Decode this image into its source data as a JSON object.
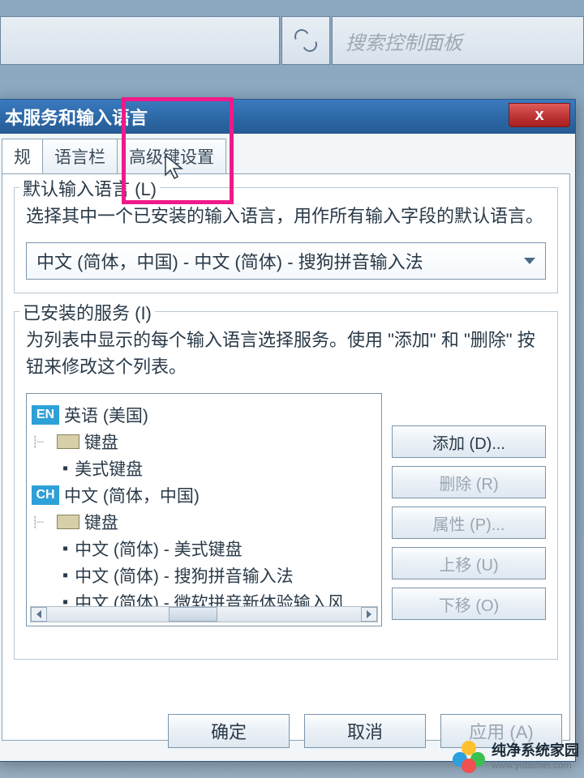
{
  "toolbar": {
    "search_placeholder": "搜索控制面板"
  },
  "dialog": {
    "title": "本服务和输入语言",
    "close_label": "x"
  },
  "tabs": {
    "general": "规",
    "language_bar": "语言栏",
    "advanced": "高级键设置"
  },
  "default_lang": {
    "legend": "默认输入语言 (L)",
    "desc": "选择其中一个已安装的输入语言，用作所有输入字段的默认语言。",
    "combo_value": "中文 (简体，中国) - 中文 (简体) - 搜狗拼音输入法"
  },
  "installed": {
    "legend": "已安装的服务 (I)",
    "desc": "为列表中显示的每个输入语言选择服务。使用 \"添加\" 和 \"删除\" 按钮来修改这个列表。",
    "tree": {
      "en_badge": "EN",
      "en_label": "英语 (美国)",
      "kb_label": "键盘",
      "en_kb1": "美式键盘",
      "ch_badge": "CH",
      "ch_label": "中文 (简体，中国)",
      "ch_kb1": "中文 (简体) - 美式键盘",
      "ch_kb2": "中文 (简体) - 搜狗拼音输入法",
      "ch_kb3": "中文 (简体) - 微软拼音新体验输入风"
    },
    "buttons": {
      "add": "添加 (D)...",
      "remove": "删除 (R)",
      "properties": "属性 (P)...",
      "move_up": "上移 (U)",
      "move_down": "下移 (O)"
    }
  },
  "bottom": {
    "ok": "确定",
    "cancel": "取消",
    "apply": "应用 (A)"
  },
  "watermark": {
    "brand": "纯净系统家园",
    "url": "www.yidaimei.com"
  }
}
